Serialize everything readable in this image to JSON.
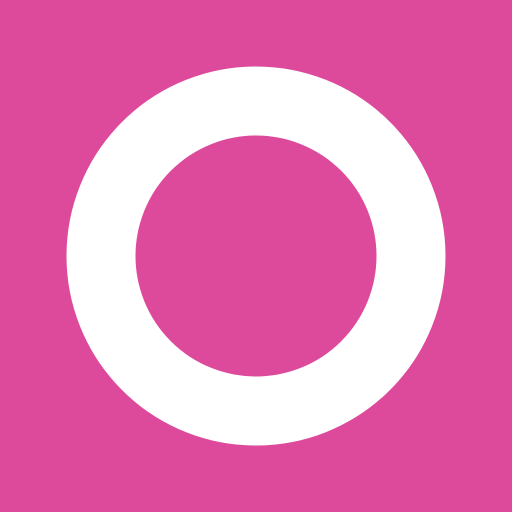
{
  "app_icon": {
    "icon": "ring-logo-icon",
    "colors": {
      "background": "#dd4a9c",
      "ring": "#ffffff"
    }
  }
}
